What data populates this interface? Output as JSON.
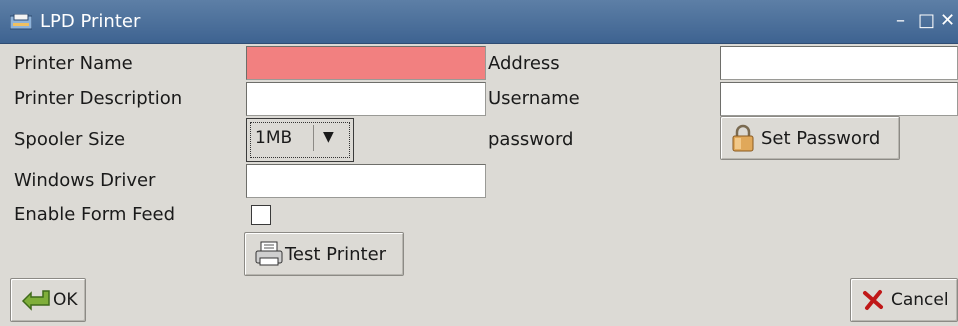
{
  "window": {
    "title": "LPD Printer",
    "minimize_glyph": "–",
    "maximize_glyph": "□",
    "close_glyph": "✕",
    "app_icon": "printer-window-icon"
  },
  "form": {
    "printer_name": {
      "label": "Printer Name",
      "value": "",
      "required": true
    },
    "printer_description": {
      "label": "Printer Description",
      "value": ""
    },
    "spooler_size": {
      "label": "Spooler Size",
      "selected": "1MB"
    },
    "windows_driver": {
      "label": "Windows Driver",
      "value": ""
    },
    "enable_form_feed": {
      "label": "Enable Form Feed",
      "checked": false
    },
    "address": {
      "label": "Address",
      "value": ""
    },
    "username": {
      "label": "Username",
      "value": ""
    },
    "password": {
      "label": "password"
    }
  },
  "buttons": {
    "set_password": "Set Password",
    "test_printer": "Test Printer",
    "ok": "OK",
    "cancel": "Cancel"
  },
  "colors": {
    "titlebar": "#4a6f9c",
    "required_field": "#f28080",
    "background": "#dcdad5"
  }
}
